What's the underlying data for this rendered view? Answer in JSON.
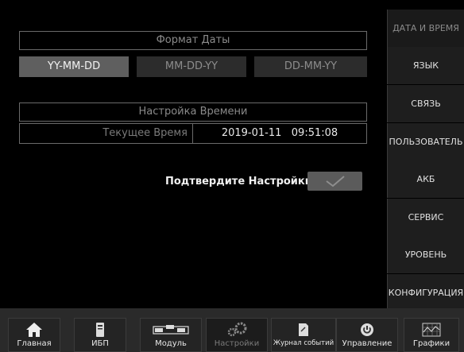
{
  "date_format": {
    "title": "Формат Даты",
    "options": [
      "YY-MM-DD",
      "MM-DD-YY",
      "DD-MM-YY"
    ],
    "selected": "YY-MM-DD"
  },
  "time_setting": {
    "title": "Настройка Времени",
    "current_label": "Текущее Время",
    "current_value": "2019-01-11   09:51:08"
  },
  "confirm": {
    "label": "Подтвердите Настройки"
  },
  "side_menu": [
    {
      "label": "ДАТА И ВРЕМЯ",
      "active": true
    },
    {
      "label": "ЯЗЫК"
    },
    {
      "label": "СВЯЗЬ"
    },
    {
      "label": "ПОЛЬЗОВАТЕЛЬ"
    },
    {
      "label": "АКБ"
    },
    {
      "label": "СЕРВИС"
    },
    {
      "label": "УРОВЕНЬ"
    },
    {
      "label": "КОНФИГУРАЦИЯ"
    }
  ],
  "bottom_tabs": [
    {
      "label": "Главная",
      "icon": "home-icon"
    },
    {
      "label": "ИБП",
      "icon": "ups-icon"
    },
    {
      "label": "Модуль",
      "icon": "module-icon"
    },
    {
      "label": "Настройки",
      "icon": "gears-icon",
      "active": true
    },
    {
      "label": "Журнал событий",
      "icon": "log-icon"
    },
    {
      "label": "Управление",
      "icon": "power-icon"
    },
    {
      "label": "Графики",
      "icon": "chart-icon"
    }
  ],
  "colors": {
    "background": "#000000",
    "selected_option": "#5f5f5f",
    "panel_border": "#6a6a6a"
  }
}
